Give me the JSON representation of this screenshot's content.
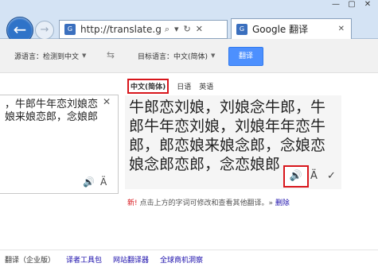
{
  "browser": {
    "address": "http://translate.g",
    "tab_title": "Google 翻译",
    "favicon_text": "G",
    "window_buttons": [
      "—",
      "▢",
      "✕"
    ],
    "address_icons": [
      "⌕",
      "▾",
      "↻",
      "✕"
    ]
  },
  "toolbar": {
    "source_lang": "源语言：检测到中文",
    "target_lang": "目标语言：中文(简体)",
    "translate_label": "翻译",
    "swap_icon": "⇆"
  },
  "source": {
    "text": "，牛郎牛年恋刘娘恋娘来娘恋郎，念娘郎",
    "speaker_glyph": "🔊",
    "transliterate_glyph": "Ä"
  },
  "result": {
    "tabs": [
      "中文(简体)",
      "日语",
      "英语"
    ],
    "text": "牛郎恋刘娘，刘娘念牛郎，牛郎牛年恋刘娘，刘娘年年恋牛郎，郎恋娘来娘念郎，念娘恋娘念郎恋郎，念恋娘郎",
    "speaker_glyph": "🔊",
    "transliterate_glyph": "Ä",
    "check_glyph": "✓"
  },
  "note": {
    "prefix": "新!",
    "text": " 点击上方的字词可修改和查看其他翻译。»",
    "action": " 删除"
  },
  "footer": {
    "items": [
      "翻译（企业版）",
      "译者工具包",
      "网站翻译器",
      "全球商机洞察"
    ]
  }
}
